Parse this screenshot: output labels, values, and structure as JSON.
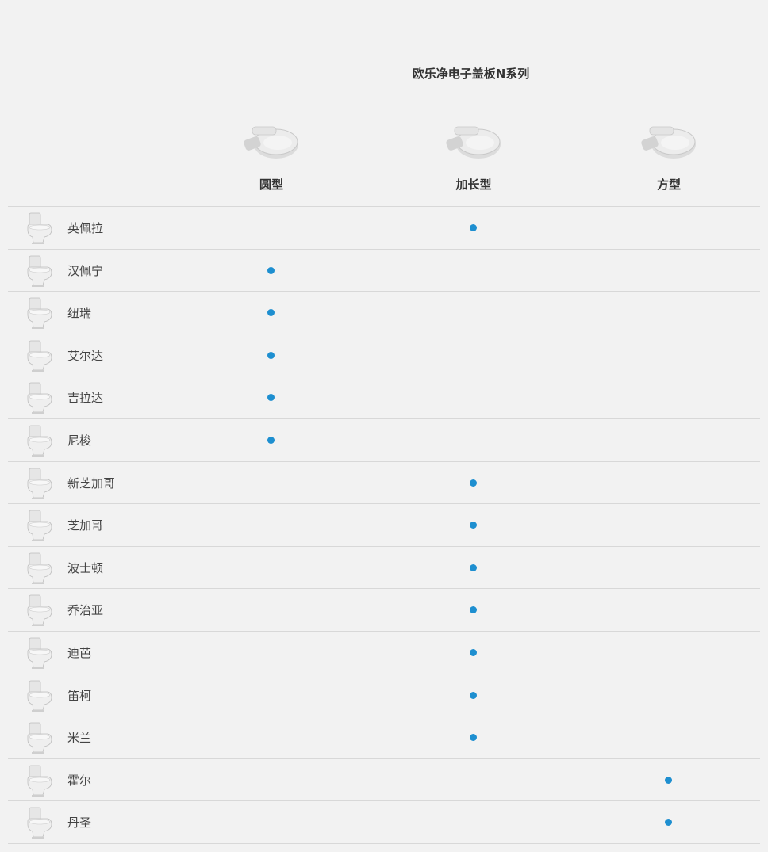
{
  "series": {
    "title": "欧乐净电子盖板N系列"
  },
  "seat_types": [
    {
      "label": "圆型",
      "icon": "round-seat-icon"
    },
    {
      "label": "加长型",
      "icon": "elongated-seat-icon"
    },
    {
      "label": "方型",
      "icon": "square-seat-icon"
    }
  ],
  "rows": [
    {
      "name": "英佩拉",
      "marks": [
        false,
        true,
        false
      ]
    },
    {
      "name": "汉佩宁",
      "marks": [
        true,
        false,
        false
      ]
    },
    {
      "name": "纽瑞",
      "marks": [
        true,
        false,
        false
      ]
    },
    {
      "name": "艾尔达",
      "marks": [
        true,
        false,
        false
      ]
    },
    {
      "name": "吉拉达",
      "marks": [
        true,
        false,
        false
      ]
    },
    {
      "name": "尼梭",
      "marks": [
        true,
        false,
        false
      ]
    },
    {
      "name": "新芝加哥",
      "marks": [
        false,
        true,
        false
      ]
    },
    {
      "name": "芝加哥",
      "marks": [
        false,
        true,
        false
      ]
    },
    {
      "name": "波士顿",
      "marks": [
        false,
        true,
        false
      ]
    },
    {
      "name": "乔治亚",
      "marks": [
        false,
        true,
        false
      ]
    },
    {
      "name": "迪芭",
      "marks": [
        false,
        true,
        false
      ]
    },
    {
      "name": "笛柯",
      "marks": [
        false,
        true,
        false
      ]
    },
    {
      "name": "米兰",
      "marks": [
        false,
        true,
        false
      ]
    },
    {
      "name": "霍尔",
      "marks": [
        false,
        false,
        true
      ]
    },
    {
      "name": "丹圣",
      "marks": [
        false,
        false,
        true
      ]
    }
  ],
  "colors": {
    "dot": "#1e8fd0",
    "background": "#f2f2f2",
    "rule": "#d8d8d8"
  }
}
